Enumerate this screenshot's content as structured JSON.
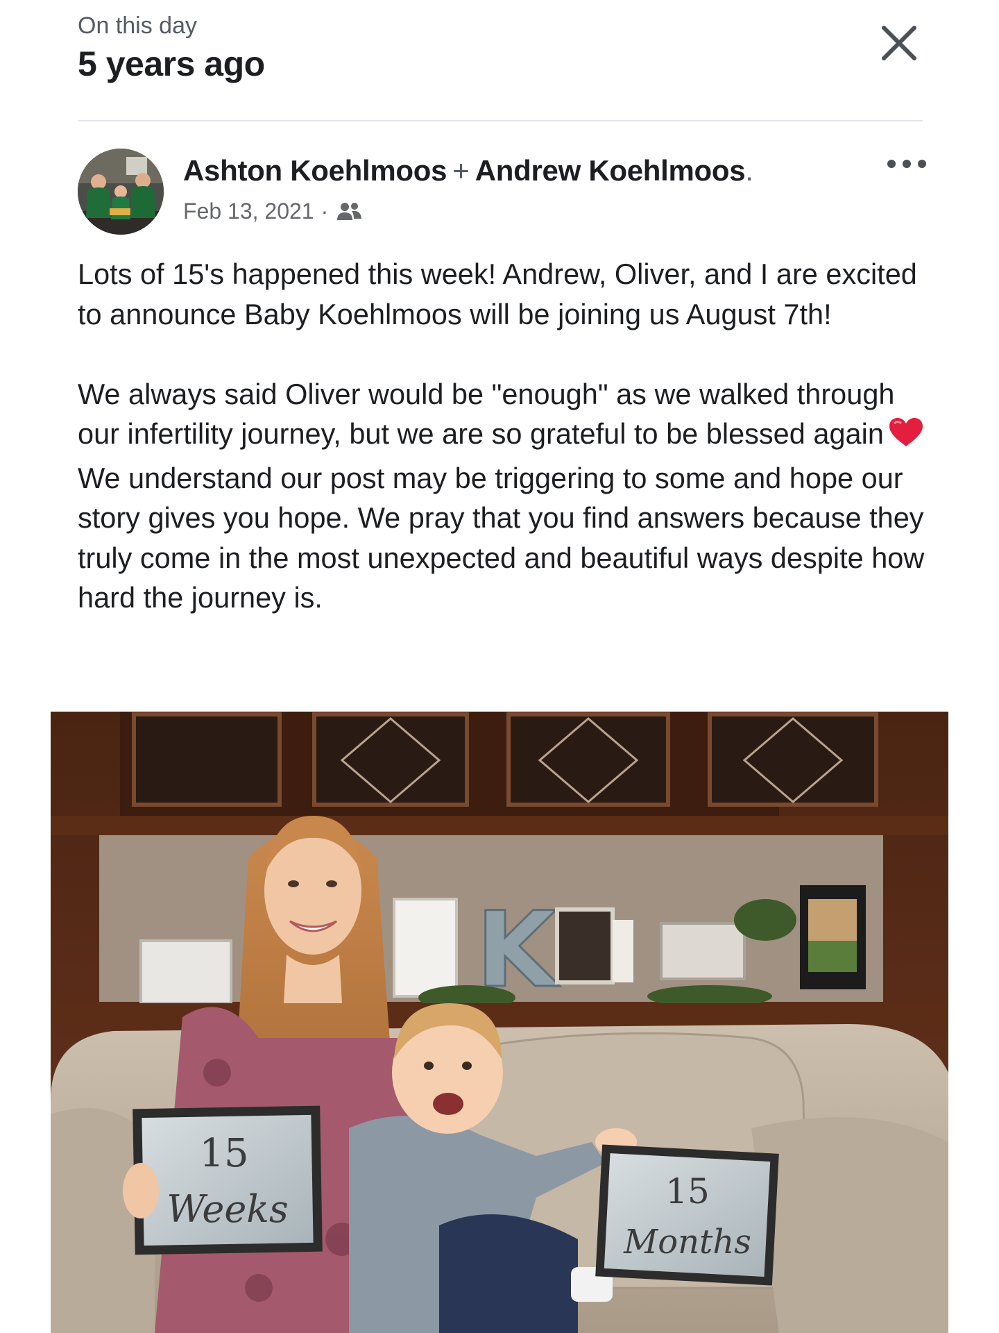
{
  "memory": {
    "kicker": "On this day",
    "title": "5 years ago"
  },
  "post": {
    "author_1": "Ashton Koehlmoos",
    "plus": "+",
    "author_2": "Andrew Koehlmoos",
    "author_suffix": ".",
    "date": "Feb 13, 2021",
    "separator": "·",
    "audience_icon": "friends-icon",
    "paragraph_1": "Lots of 15's happened this week! Andrew, Oliver, and I are excited to announce Baby Koehlmoos will be joining us August 7th!",
    "paragraph_2_before_emoji": "We always said Oliver would be \"enough\" as we walked through our infertility journey, but we are so grateful to be blessed again",
    "paragraph_2_after_emoji": "We understand our post may be triggering to some and hope our story gives you hope. We pray that you find answers because they truly come in the most unexpected and beautiful ways despite how hard the journey is.",
    "emoji": "red-heart-icon"
  },
  "photo": {
    "sign_left_number": "15",
    "sign_left_word": "Weeks",
    "sign_right_number": "15",
    "sign_right_word": "Months",
    "letter": "K"
  },
  "colors": {
    "text": "#1c1e21",
    "secondary_text": "#65676b",
    "divider": "#e4e6eb",
    "heart": "#e41e3f"
  }
}
